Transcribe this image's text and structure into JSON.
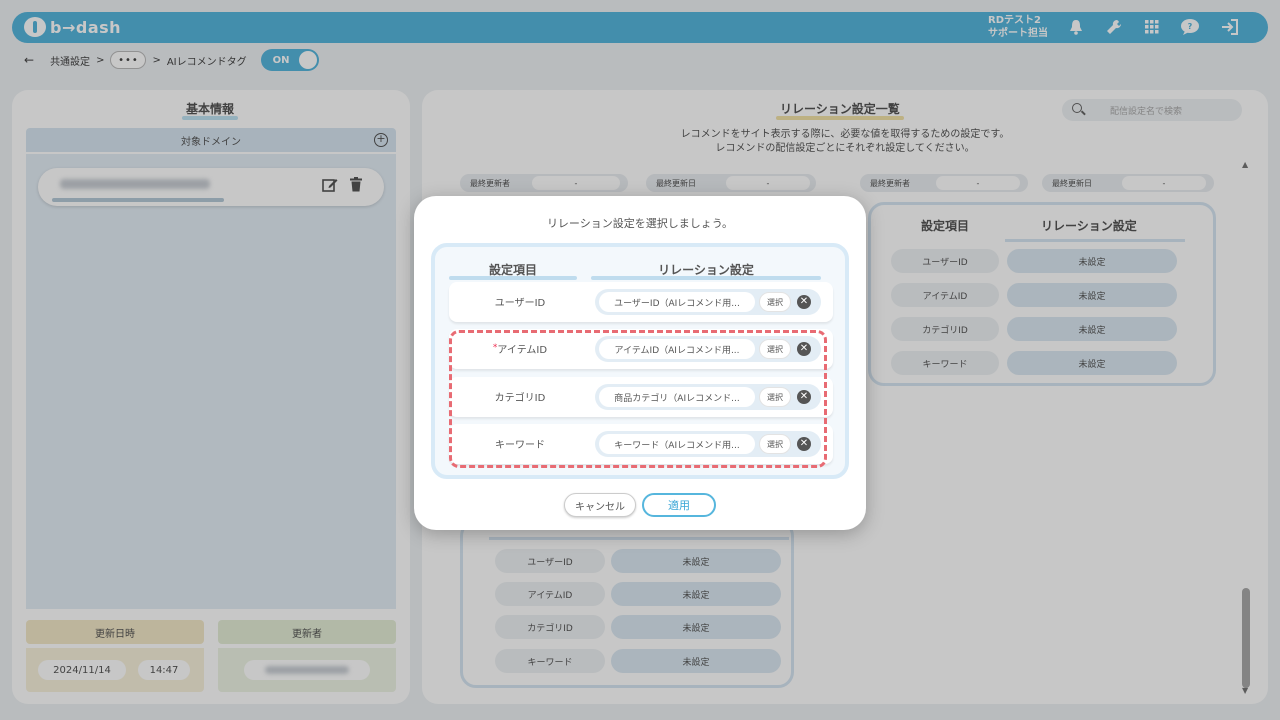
{
  "header": {
    "logo": "b→dash",
    "user_line1": "RDテスト2",
    "user_line2": "サポート担当",
    "icons": [
      "bell-icon",
      "wrench-icon",
      "grid-icon",
      "help-icon",
      "logout-icon"
    ]
  },
  "breadcrumb": {
    "item1": "共通設定",
    "sep": ">",
    "more": "•••",
    "current": "AIレコメンドタグ",
    "toggle": "ON"
  },
  "left": {
    "title": "基本情報",
    "domain_header": "対象ドメイン",
    "updated_at_label": "更新日時",
    "updated_by_label": "更新者",
    "date": "2024/11/14",
    "time": "14:47"
  },
  "right": {
    "title": "リレーション設定一覧",
    "search_placeholder": "配信設定名で検索",
    "desc_line1": "レコメンドをサイト表示する際に、必要な値を取得するための設定です。",
    "desc_line2": "レコメンドの配信設定ごとにそれぞれ設定してください。",
    "meta_updated_by": "最終更新者",
    "meta_updated_at": "最終更新日",
    "meta_value": "-",
    "col_item": "設定項目",
    "col_relation": "リレーション設定",
    "rows": [
      "ユーザーID",
      "アイテムID",
      "カテゴリID",
      "キーワード"
    ],
    "unset": "未設定"
  },
  "modal": {
    "title": "リレーション設定を選択しましょう。",
    "col_item": "設定項目",
    "col_relation": "リレーション設定",
    "rows": [
      {
        "label": "ユーザーID",
        "required": "",
        "value": "ユーザーID（AIレコメンド用..."
      },
      {
        "label": "アイテムID",
        "required": "*",
        "value": "アイテムID（AIレコメンド用..."
      },
      {
        "label": "カテゴリID",
        "required": "",
        "value": "商品カテゴリ（AIレコメンド..."
      },
      {
        "label": "キーワード",
        "required": "",
        "value": "キーワード（AIレコメンド用..."
      }
    ],
    "select_label": "選択",
    "clear_glyph": "✕",
    "cancel": "キャンセル",
    "apply": "適用"
  }
}
